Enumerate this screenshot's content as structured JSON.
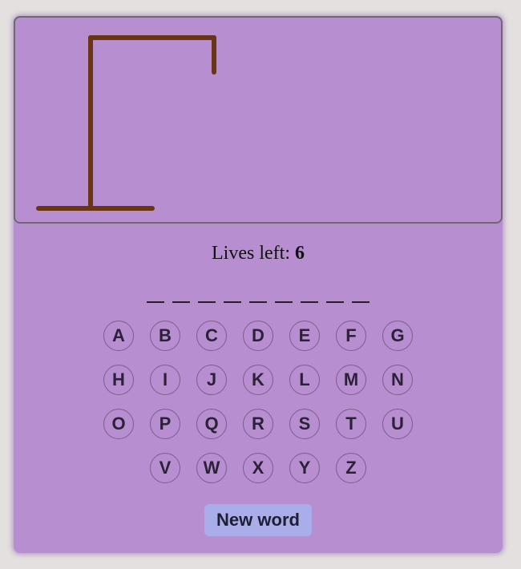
{
  "lives": {
    "label": "Lives left:",
    "count": "6"
  },
  "word": {
    "length": 9
  },
  "keyboard": {
    "rows": [
      [
        "A",
        "B",
        "C",
        "D",
        "E",
        "F",
        "G"
      ],
      [
        "H",
        "I",
        "J",
        "K",
        "L",
        "M",
        "N"
      ],
      [
        "O",
        "P",
        "Q",
        "R",
        "S",
        "T",
        "U"
      ],
      [
        "V",
        "W",
        "X",
        "Y",
        "Z"
      ]
    ]
  },
  "button": {
    "new_word": "New word"
  },
  "colors": {
    "background": "#e3e0df",
    "card": "#b78ecf",
    "gallows": "#6a3514",
    "button": "#a9aeea"
  }
}
